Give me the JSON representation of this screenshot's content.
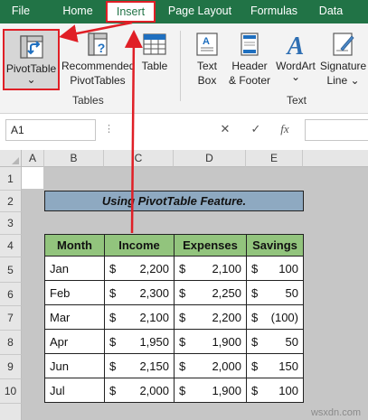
{
  "ribbon_tabs": [
    {
      "label": "File"
    },
    {
      "label": "Home"
    },
    {
      "label": "Insert"
    },
    {
      "label": "Page Layout"
    },
    {
      "label": "Formulas"
    },
    {
      "label": "Data"
    }
  ],
  "active_tab": "Insert",
  "ribbon": {
    "pivot_table": {
      "label": "PivotTable",
      "dropdown": "⌄"
    },
    "recommended": {
      "label_line1": "Recommended",
      "label_line2": "PivotTables"
    },
    "table": {
      "label": "Table"
    },
    "tables_group": "Tables",
    "text_box": {
      "label_line1": "Text",
      "label_line2": "Box"
    },
    "header_footer": {
      "label_line1": "Header",
      "label_line2": "& Footer"
    },
    "wordart": {
      "label": "WordArt",
      "dropdown": "⌄"
    },
    "signature": {
      "label_line1": "Signature",
      "label_line2": "Line",
      "dropdown": "⌄"
    },
    "text_group": "Text"
  },
  "formula_bar": {
    "name_box": "A1",
    "cancel": "✕",
    "enter": "✓",
    "fx": "fx"
  },
  "columns": [
    "A",
    "B",
    "C",
    "D",
    "E"
  ],
  "rows": [
    "1",
    "2",
    "3",
    "4",
    "5",
    "6",
    "7",
    "8",
    "9",
    "10"
  ],
  "sheet": {
    "title": "Using PivotTable Feature.",
    "headers": [
      "Month",
      "Income",
      "Expenses",
      "Savings"
    ],
    "currency": "$",
    "data": [
      {
        "month": "Jan",
        "income": "2,200",
        "expenses": "2,100",
        "savings": "100"
      },
      {
        "month": "Feb",
        "income": "2,300",
        "expenses": "2,250",
        "savings": "50"
      },
      {
        "month": "Mar",
        "income": "2,100",
        "expenses": "2,200",
        "savings": "(100)"
      },
      {
        "month": "Apr",
        "income": "1,950",
        "expenses": "1,900",
        "savings": "50"
      },
      {
        "month": "Jun",
        "income": "2,150",
        "expenses": "2,000",
        "savings": "150"
      },
      {
        "month": "Jul",
        "income": "2,000",
        "expenses": "1,900",
        "savings": "100"
      }
    ]
  },
  "watermark": "wsxdn.com",
  "colors": {
    "ribbon_tab_bar": "#217346",
    "highlight": "#e01f26",
    "title_fill": "#8ea9c1",
    "header_fill": "#92c47d"
  }
}
